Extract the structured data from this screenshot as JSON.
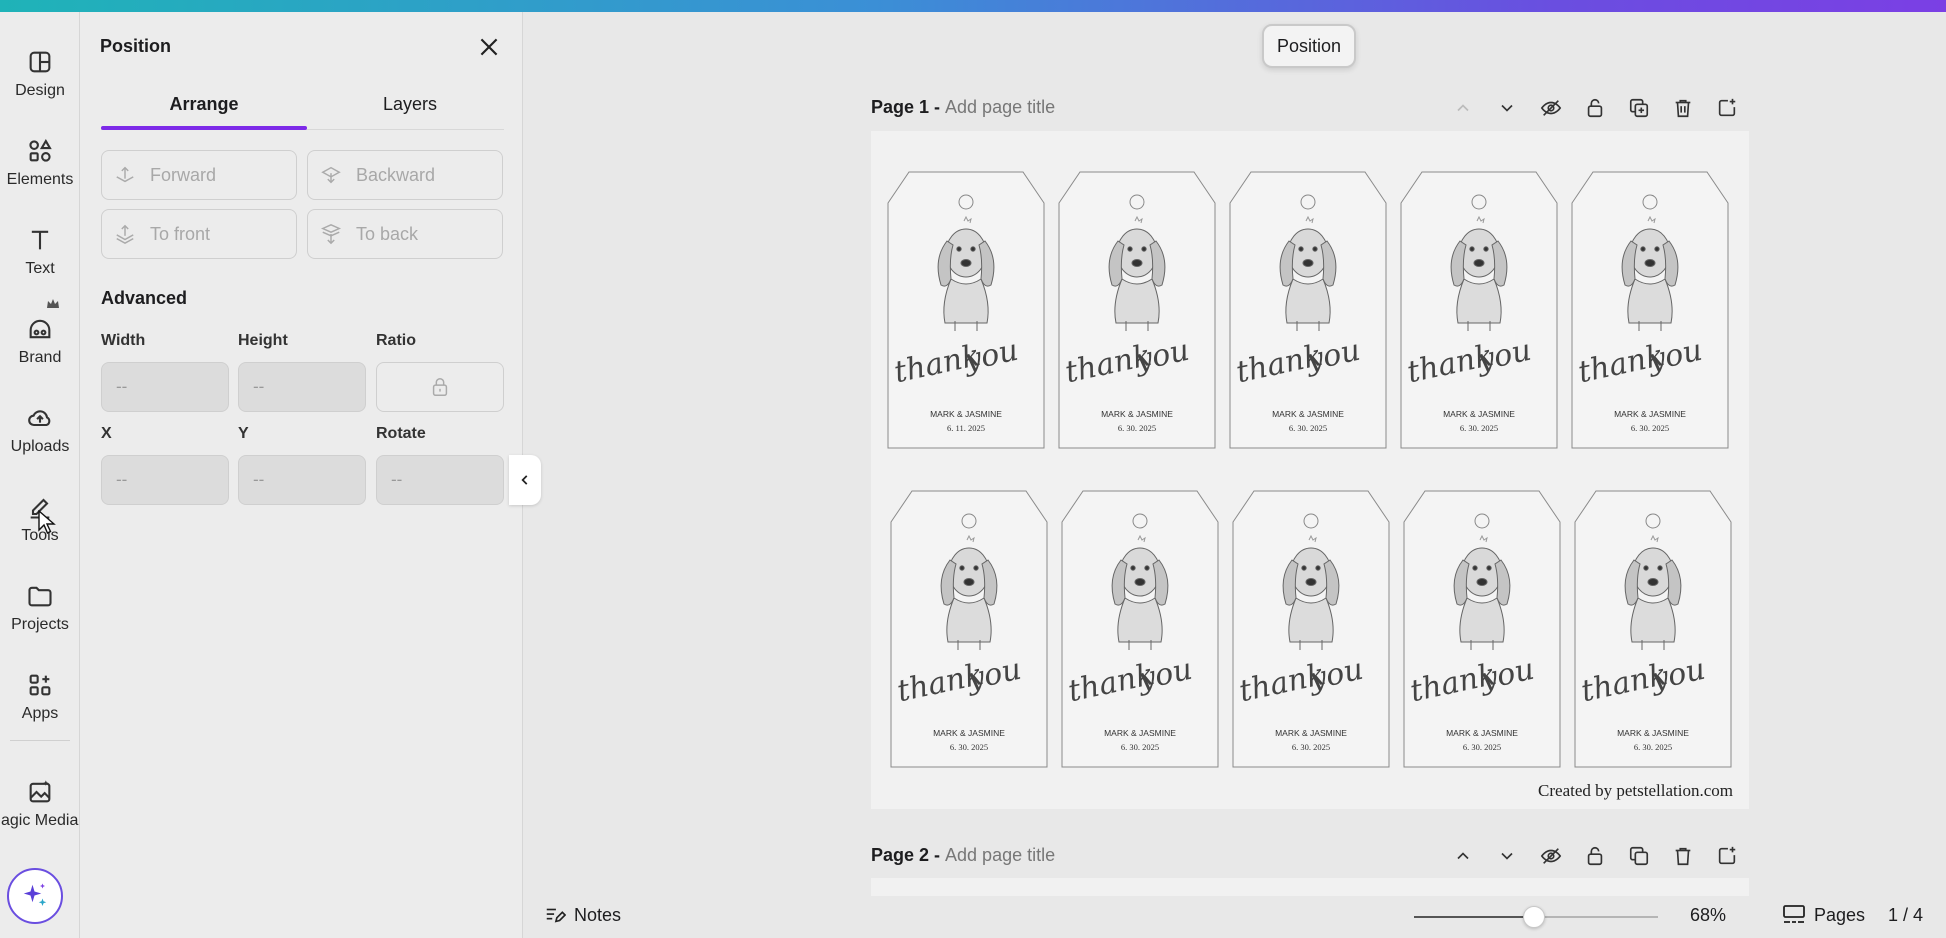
{
  "rail": {
    "items": [
      {
        "label": "Design",
        "icon": "design-icon"
      },
      {
        "label": "Elements",
        "icon": "elements-icon"
      },
      {
        "label": "Text",
        "icon": "text-icon"
      },
      {
        "label": "Brand",
        "icon": "brand-icon"
      },
      {
        "label": "Uploads",
        "icon": "uploads-icon"
      },
      {
        "label": "Tools",
        "icon": "tools-icon"
      },
      {
        "label": "Projects",
        "icon": "projects-icon"
      },
      {
        "label": "Apps",
        "icon": "apps-icon"
      },
      {
        "label": "Magic Media",
        "icon": "magic-media-icon"
      }
    ]
  },
  "panel": {
    "title": "Position",
    "tabs": [
      {
        "label": "Arrange"
      },
      {
        "label": "Layers"
      }
    ],
    "arrange_buttons": [
      "Forward",
      "Backward",
      "To front",
      "To back"
    ],
    "advanced_title": "Advanced",
    "fields": {
      "width": {
        "label": "Width",
        "value": "--"
      },
      "height": {
        "label": "Height",
        "value": "--"
      },
      "ratio": {
        "label": "Ratio"
      },
      "x": {
        "label": "X",
        "value": "--"
      },
      "y": {
        "label": "Y",
        "value": "--"
      },
      "rotate": {
        "label": "Rotate",
        "value": "--"
      }
    }
  },
  "canvas": {
    "position_pill": "Position",
    "page1": {
      "label": "Page 1 - ",
      "placeholder": "Add page title"
    },
    "page2": {
      "label": "Page 2 - ",
      "placeholder": "Add page title"
    },
    "tag_text": {
      "script_a": "thank",
      "script_b": "you",
      "names": "MARK & JASMINE"
    },
    "tag_dates": [
      "6. 11. 2025",
      "6. 30. 2025",
      "6. 30. 2025",
      "6. 30. 2025",
      "6. 30. 2025",
      "6. 30. 2025",
      "6. 30. 2025",
      "6. 30. 2025",
      "6. 30. 2025",
      "6. 30. 2025"
    ],
    "credit": "Created by petstellation.com"
  },
  "bottom_bar": {
    "notes": "Notes",
    "zoom": "68%",
    "zoom_fraction": 0.49,
    "pages": "Pages",
    "page_count": "1 / 4"
  },
  "colors": {
    "accent": "#7d2ae8",
    "gradient_start": "#1fb3b8",
    "gradient_end": "#7b3fe4"
  }
}
